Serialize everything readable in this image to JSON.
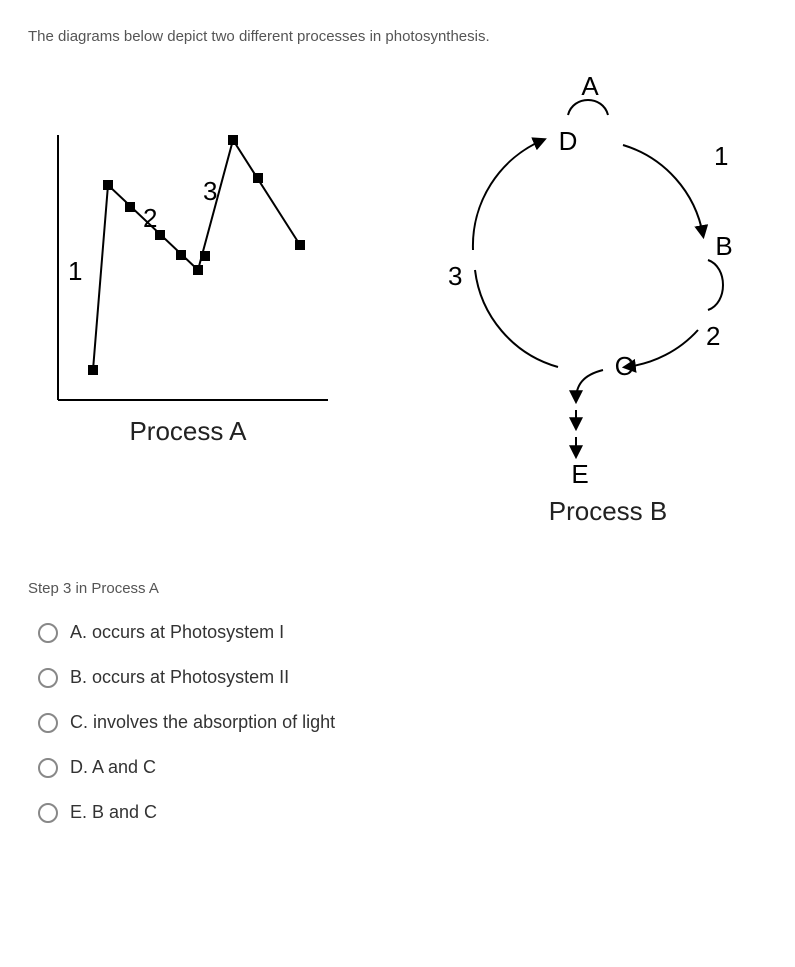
{
  "intro": "The diagrams below depict two different processes in photosynthesis.",
  "processA": {
    "label": "Process A",
    "numbers": {
      "n1": "1",
      "n2": "2",
      "n3": "3"
    }
  },
  "processB": {
    "label": "Process B",
    "letters": {
      "A": "A",
      "B": "B",
      "C": "C",
      "D": "D",
      "E": "E"
    },
    "numbers": {
      "n1": "1",
      "n2": "2",
      "n3": "3"
    }
  },
  "question_stem": "Step 3 in Process A",
  "options": {
    "a": "A. occurs at Photosystem I",
    "b": "B. occurs at Photosystem II",
    "c": "C. involves the absorption of light",
    "d": "D. A and C",
    "e": "E. B and C"
  }
}
